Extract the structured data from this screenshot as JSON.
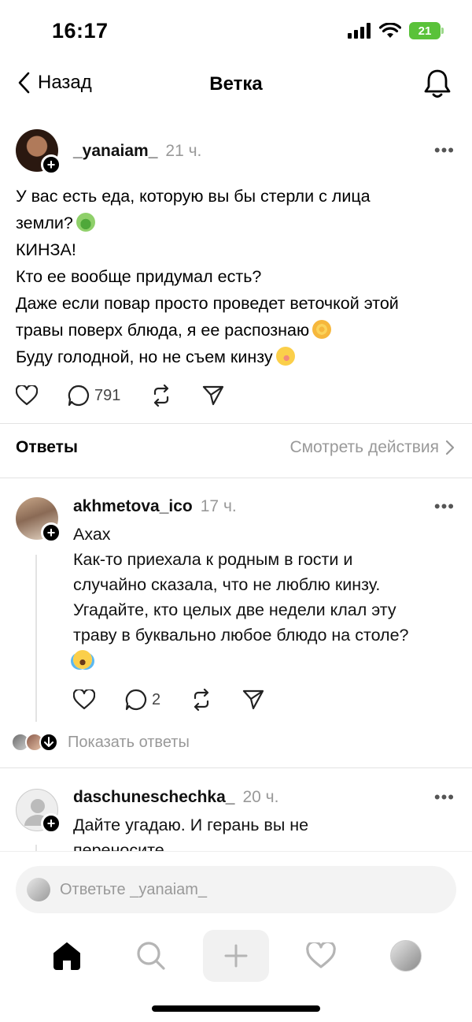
{
  "status_bar": {
    "time": "16:17",
    "battery": "21"
  },
  "nav": {
    "back_label": "Назад",
    "title": "Ветка"
  },
  "post": {
    "username": "_yanaiam_",
    "time": "21 ч.",
    "lines": [
      "У вас есть еда, которую вы бы стерли с лица",
      "земли?",
      "КИНЗА!",
      "Кто ее вообще придумал есть?",
      "Даже если повар просто проведет веточкой этой",
      "травы поверх блюда, я ее распознаю",
      "Буду голодной, но не съем кинзу"
    ],
    "emojis": [
      "nauseated-face",
      "dizzy-face",
      "woozy-face"
    ],
    "reply_count": "791"
  },
  "replies_section": {
    "title": "Ответы",
    "view_activity": "Смотреть действия"
  },
  "replies": [
    {
      "username": "akhmetova_ico",
      "time": "17 ч.",
      "lines": [
        "Ахах",
        "Как-то приехала к родным в гости и",
        "случайно сказала, что не люблю кинзу.",
        "Угадайте, кто целых две недели клал эту",
        "траву в буквально любое блюдо на столе?"
      ],
      "emoji": "tears-of-joy",
      "reply_count": "2",
      "show_replies": "Показать ответы"
    },
    {
      "username": "daschuneschechka_",
      "time": "20 ч.",
      "lines": [
        "Дайте угадаю. И герань вы не",
        "переносите"
      ]
    }
  ],
  "reply_bar": {
    "placeholder": "Ответьте _yanaiam_"
  },
  "tabs": [
    "home-icon",
    "search-icon",
    "add-icon",
    "heart-icon",
    "profile-avatar"
  ],
  "colors": {
    "accent": "#000000",
    "muted": "#999999",
    "battery": "#5ac23a"
  }
}
